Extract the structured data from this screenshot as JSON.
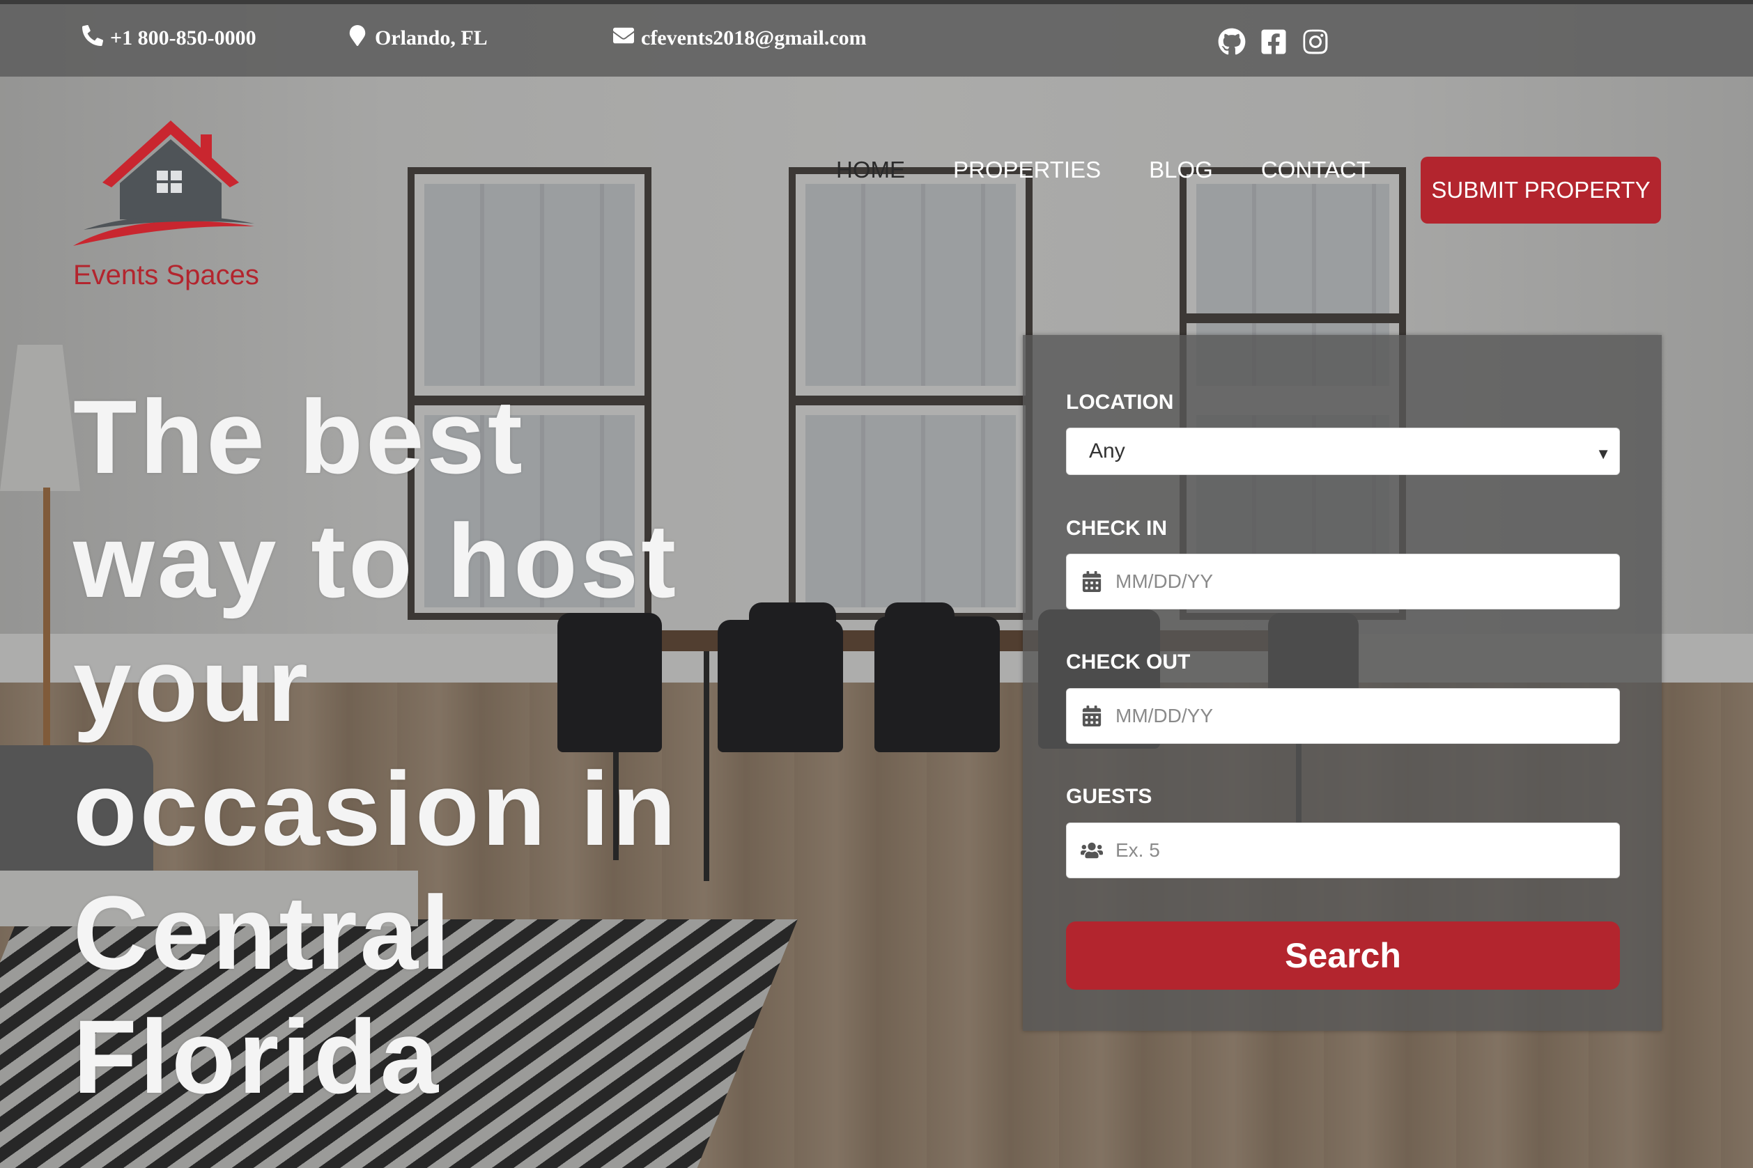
{
  "contact": {
    "phone": "+1 800-850-0000",
    "location": "Orlando, FL",
    "email": "cfevents2018@gmail.com"
  },
  "social": [
    "github-icon",
    "facebook-icon",
    "instagram-icon"
  ],
  "brand": {
    "name": "Events Spaces",
    "color": "#b3252e"
  },
  "nav": {
    "items": [
      {
        "label": "HOME",
        "active": true
      },
      {
        "label": "PROPERTIES",
        "active": false
      },
      {
        "label": "BLOG",
        "active": false
      },
      {
        "label": "CONTACT",
        "active": false
      }
    ],
    "cta": "SUBMIT PROPERTY"
  },
  "hero": {
    "lines": [
      "The best",
      "way to host",
      "your",
      "occasion in",
      "Central",
      "Florida"
    ]
  },
  "search": {
    "location_label": "LOCATION",
    "location_value": "Any",
    "checkin_label": "CHECK IN",
    "checkin_placeholder": "MM/DD/YY",
    "checkout_label": "CHECK OUT",
    "checkout_placeholder": "MM/DD/YY",
    "guests_label": "GUESTS",
    "guests_placeholder": "Ex. 5",
    "button": "Search"
  }
}
